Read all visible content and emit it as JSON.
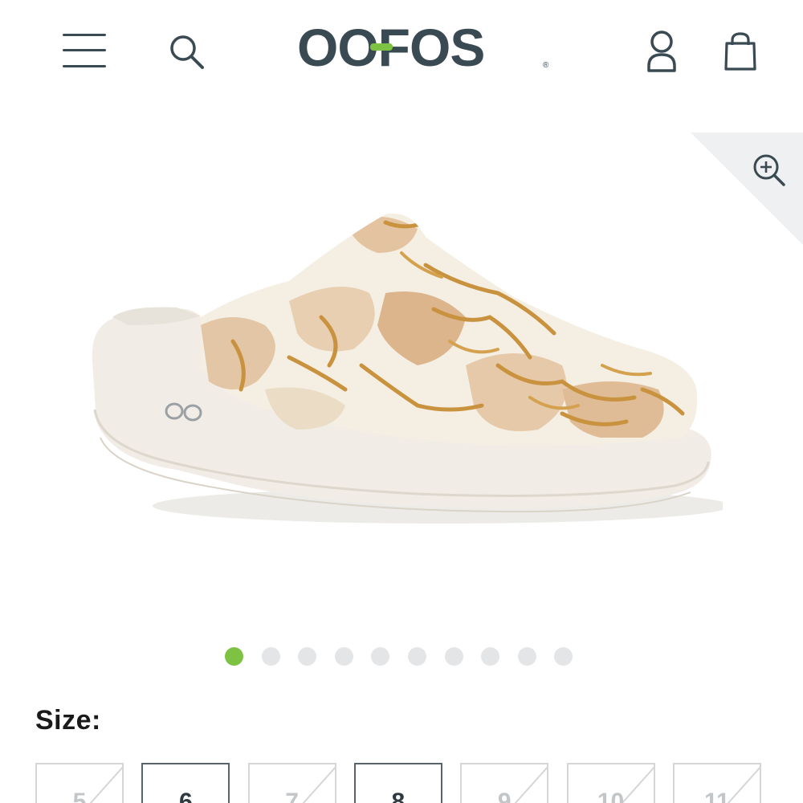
{
  "header": {
    "logo_text": "OOFOS",
    "logo_registered": "®",
    "icons": [
      "menu-icon",
      "search-icon",
      "account-icon",
      "bag-icon"
    ]
  },
  "gallery": {
    "zoom_icon": "zoom-in-icon",
    "dots_total": 10,
    "active_dot": 1
  },
  "size": {
    "label": "Size:",
    "options": [
      {
        "value": "5",
        "available": false
      },
      {
        "value": "6",
        "available": true
      },
      {
        "value": "7",
        "available": false
      },
      {
        "value": "8",
        "available": true
      },
      {
        "value": "9",
        "available": false
      },
      {
        "value": "10",
        "available": false
      },
      {
        "value": "11",
        "available": false
      }
    ]
  },
  "colors": {
    "brand_dark": "#3a4a52",
    "brand_green": "#7dc242",
    "dot_inactive": "#e3e5e6",
    "border_available": "#58636a",
    "border_unavailable": "#d4d6d8"
  }
}
